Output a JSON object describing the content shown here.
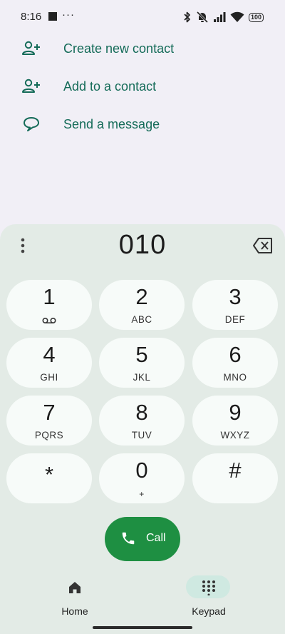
{
  "status_bar": {
    "time": "8:16",
    "overflow": "···",
    "battery": "100"
  },
  "actions": [
    {
      "label": "Create new contact",
      "icon": "person-add-icon"
    },
    {
      "label": "Add to a contact",
      "icon": "person-add-icon"
    },
    {
      "label": "Send a message",
      "icon": "message-icon"
    }
  ],
  "dialer": {
    "number": "010",
    "keys": [
      {
        "digit": "1",
        "letters": ""
      },
      {
        "digit": "2",
        "letters": "ABC"
      },
      {
        "digit": "3",
        "letters": "DEF"
      },
      {
        "digit": "4",
        "letters": "GHI"
      },
      {
        "digit": "5",
        "letters": "JKL"
      },
      {
        "digit": "6",
        "letters": "MNO"
      },
      {
        "digit": "7",
        "letters": "PQRS"
      },
      {
        "digit": "8",
        "letters": "TUV"
      },
      {
        "digit": "9",
        "letters": "WXYZ"
      },
      {
        "digit": "*",
        "letters": ""
      },
      {
        "digit": "0",
        "letters": "+"
      },
      {
        "digit": "#",
        "letters": ""
      }
    ],
    "call_label": "Call"
  },
  "bottom_nav": {
    "home_label": "Home",
    "keypad_label": "Keypad"
  },
  "colors": {
    "accent_green": "#1e8f42",
    "action_text": "#146b58",
    "panel_bg": "#e3ebe6",
    "key_bg": "#f7fbf9"
  }
}
